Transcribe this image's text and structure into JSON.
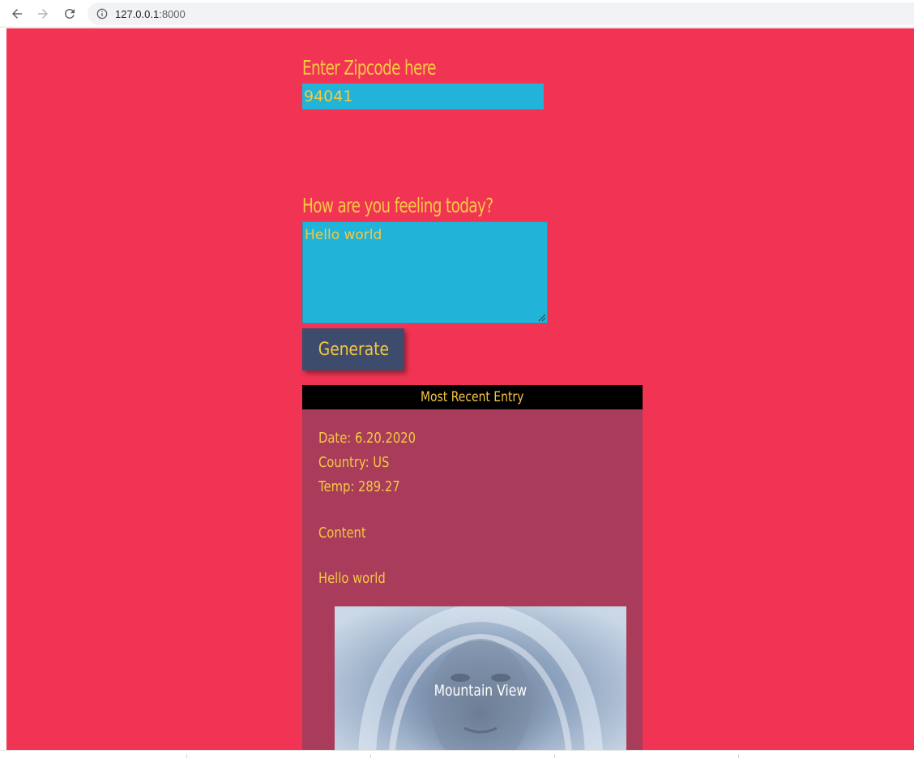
{
  "browser": {
    "url_host": "127.0.0.1",
    "url_port": ":8000",
    "icons": [
      "back-arrow-icon",
      "forward-arrow-icon",
      "reload-icon",
      "info-icon"
    ]
  },
  "form": {
    "zip_label": "Enter Zipcode here",
    "zip_value": "94041",
    "feeling_label": "How are you feeling today?",
    "feeling_value": "Hello world",
    "generate_label": "Generate"
  },
  "entry": {
    "title": "Most Recent Entry",
    "date": "Date: 6.20.2020",
    "country": "Country: US",
    "temp": "Temp: 289.27",
    "content_label": "Content",
    "content_value": "Hello world",
    "photo_caption": "Mountain View"
  },
  "colors": {
    "page_bg": "#f13453",
    "accent_text": "#f5c842",
    "input_bg": "#22b3d8",
    "button_bg": "#3d4b6c",
    "entry_bg": "#a83c5a",
    "entry_header_bg": "#000000"
  }
}
